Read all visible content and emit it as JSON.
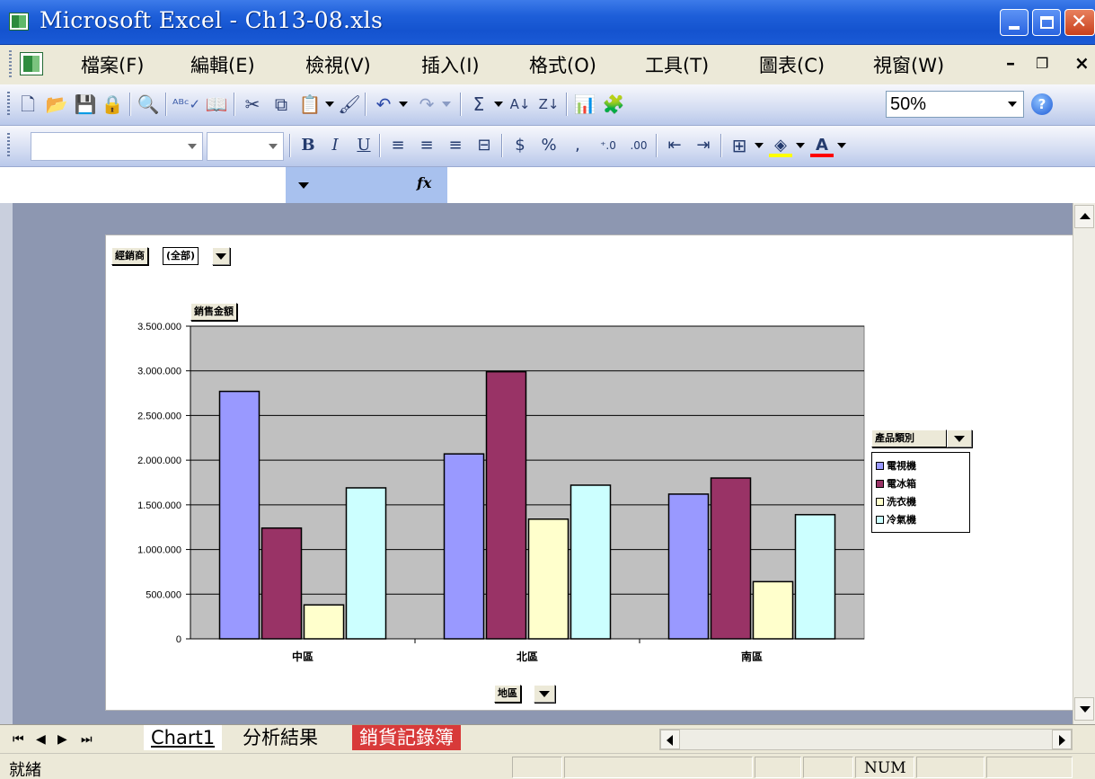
{
  "window": {
    "title": "Microsoft Excel - Ch13-08.xls"
  },
  "menu": {
    "items": [
      "檔案(F)",
      "編輯(E)",
      "檢視(V)",
      "插入(I)",
      "格式(O)",
      "工具(T)",
      "圖表(C)",
      "視窗(W)"
    ]
  },
  "toolbar": {
    "zoom": "50%"
  },
  "formula_bar": {
    "fx": "fx"
  },
  "pivot": {
    "page_field": "經銷商",
    "page_value": "(全部)",
    "data_field": "銷售金額",
    "category_field": "地區",
    "series_field": "產品類別"
  },
  "chart_data": {
    "type": "bar",
    "categories": [
      "中區",
      "北區",
      "南區"
    ],
    "series": [
      {
        "name": "電視機",
        "values": [
          2770000,
          2070000,
          1620000
        ],
        "color": "#9999ff"
      },
      {
        "name": "電冰箱",
        "values": [
          1240000,
          2990000,
          1800000
        ],
        "color": "#993366"
      },
      {
        "name": "洗衣機",
        "values": [
          380000,
          1340000,
          640000
        ],
        "color": "#ffffcc"
      },
      {
        "name": "冷氣機",
        "values": [
          1690000,
          1720000,
          1390000
        ],
        "color": "#ccffff"
      }
    ],
    "ylim": [
      0,
      3500000
    ],
    "yticks": [
      "0",
      "500.000",
      "1.000.000",
      "1.500.000",
      "2.000.000",
      "2.500.000",
      "3.000.000",
      "3.500.000"
    ],
    "plot_background": "#c0c0c0",
    "grid": true
  },
  "sheets": {
    "tabs": [
      "Chart1",
      "分析結果",
      "銷貨記錄簿"
    ]
  },
  "status": {
    "ready": "就緒",
    "num": "NUM"
  }
}
